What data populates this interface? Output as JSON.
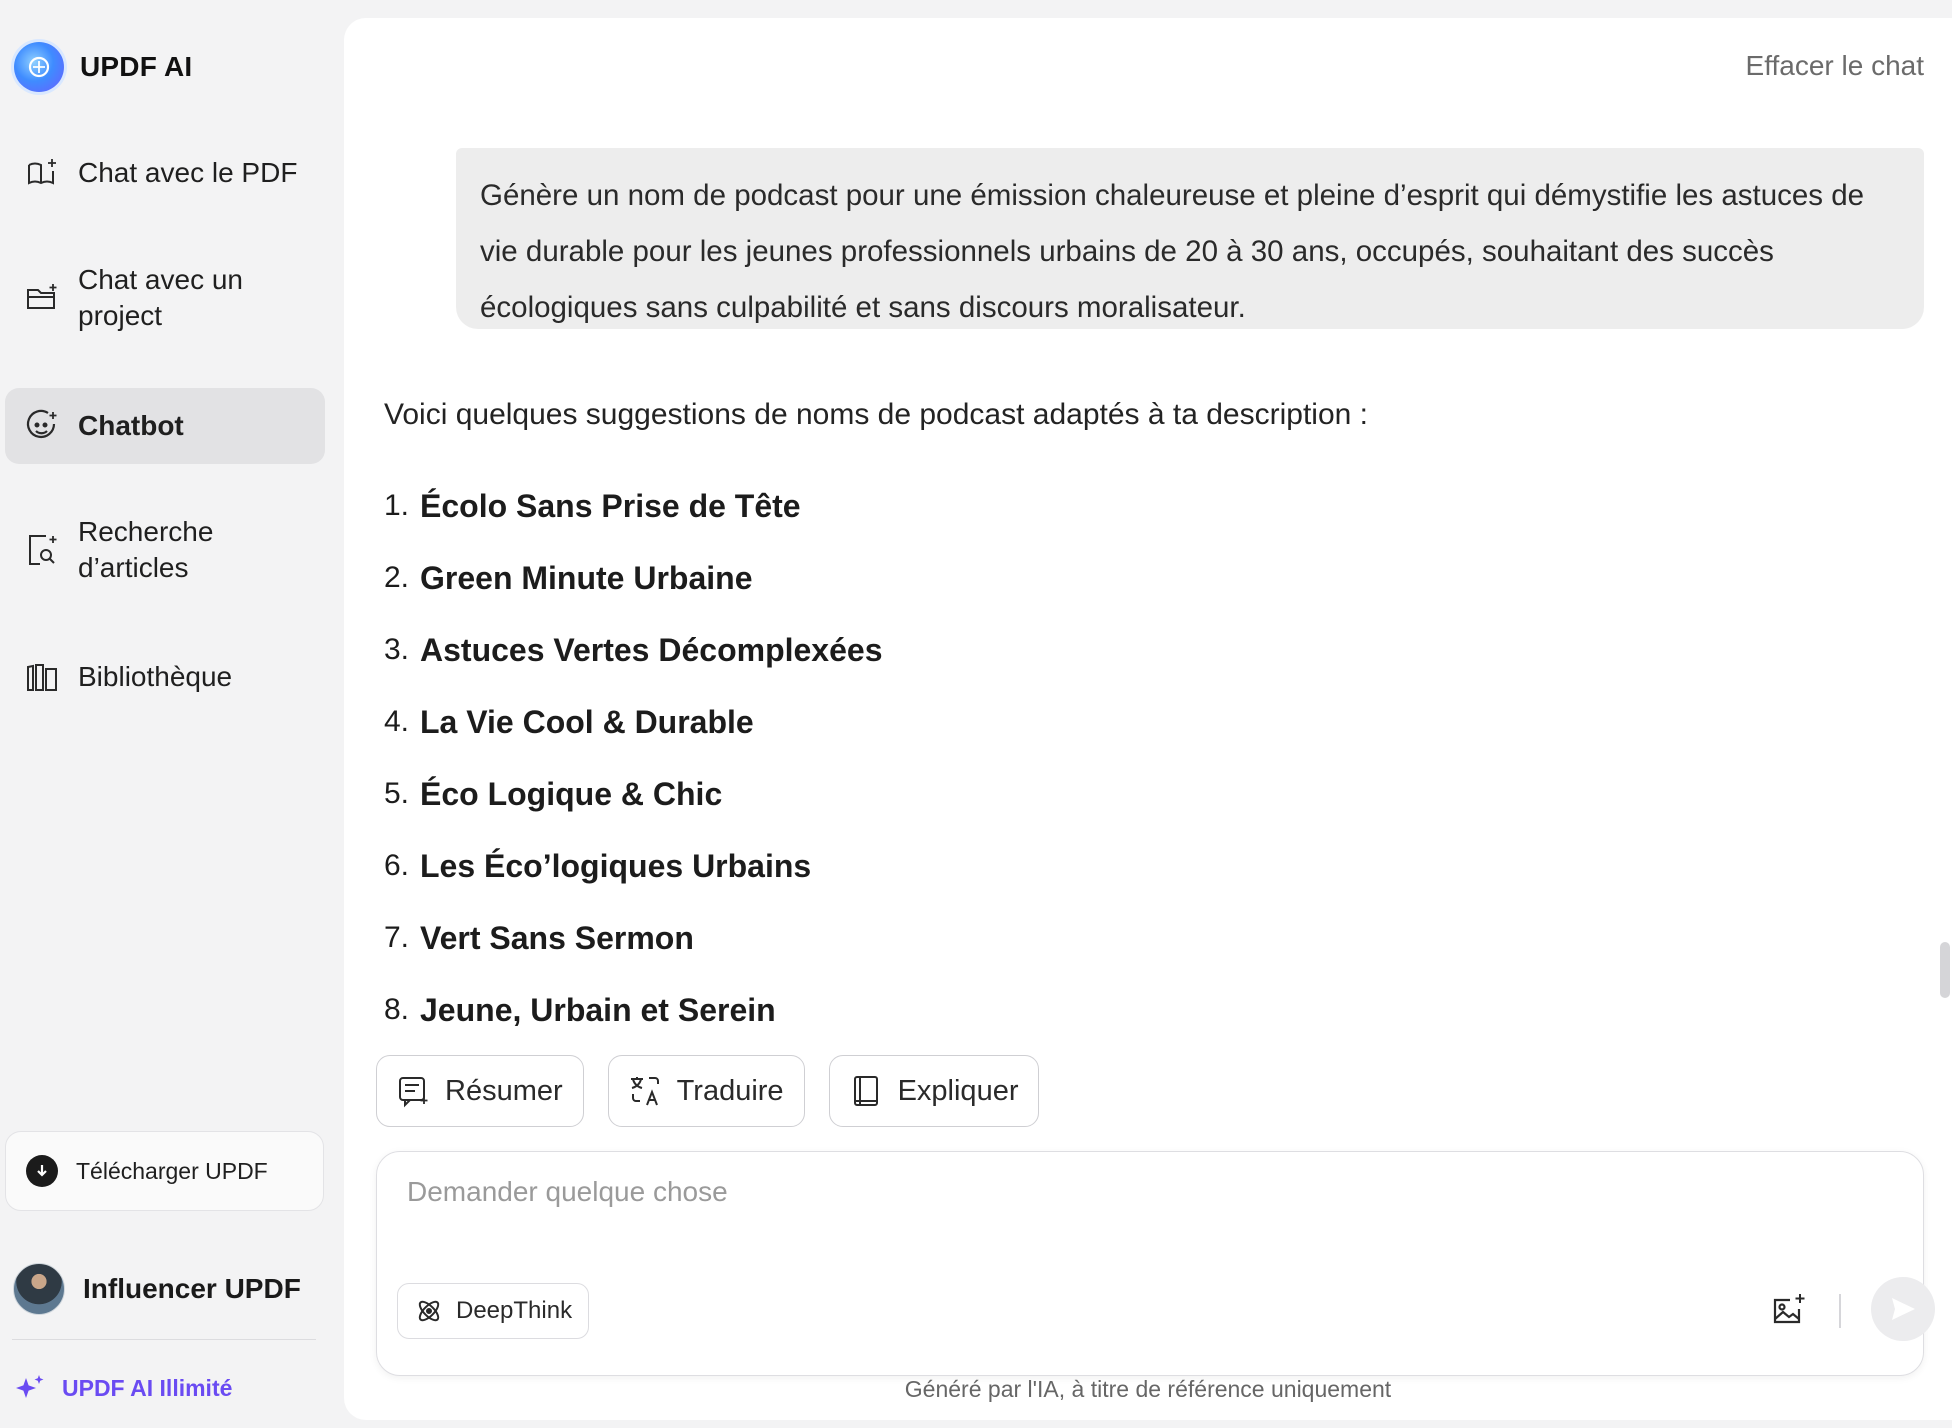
{
  "brand": {
    "name": "UPDF AI"
  },
  "sidebar": {
    "items": [
      {
        "label": "Chat avec le PDF",
        "icon": "book-sparkle-icon"
      },
      {
        "label": "Chat avec un project",
        "icon": "folder-sparkle-icon"
      },
      {
        "label": "Chatbot",
        "icon": "chatbot-face-icon",
        "active": true
      },
      {
        "label": "Recherche d’articles",
        "icon": "document-search-icon"
      },
      {
        "label": "Bibliothèque",
        "icon": "library-icon"
      }
    ],
    "download_label": "Télécharger UPDF",
    "user_name": "Influencer UPDF",
    "upgrade_label": "UPDF AI Illimité"
  },
  "header": {
    "clear_chat": "Effacer le chat"
  },
  "conversation": {
    "user_message": "Génère un nom de podcast pour une émission chaleureuse et pleine d’esprit qui démystifie les astuces de vie durable pour les jeunes professionnels urbains de 20 à 30 ans, occupés, souhaitant des succès écologiques sans culpabilité et sans discours moralisateur.",
    "answer_intro": "Voici quelques suggestions de noms de podcast adaptés à ta description :",
    "suggestions": [
      {
        "num": "1.",
        "text": "Écolo Sans Prise de Tête"
      },
      {
        "num": "2.",
        "text": "Green Minute Urbaine"
      },
      {
        "num": "3.",
        "text": "Astuces Vertes Décomplexées"
      },
      {
        "num": "4.",
        "text": "La Vie Cool & Durable"
      },
      {
        "num": "5.",
        "text": "Éco Logique & Chic"
      },
      {
        "num": "6.",
        "text": "Les Éco’logiques Urbains"
      },
      {
        "num": "7.",
        "text": "Vert Sans Sermon"
      },
      {
        "num": "8.",
        "text": "Jeune, Urbain et Serein"
      }
    ]
  },
  "actions": {
    "summarize": "Résumer",
    "translate": "Traduire",
    "explain": "Expliquer"
  },
  "composer": {
    "placeholder": "Demander quelque chose",
    "deepthink_label": "DeepThink"
  },
  "footer": {
    "disclaimer": "Généré par l'IA, à titre de référence uniquement"
  },
  "colors": {
    "accent": "#6a4bf2",
    "sidebar_bg": "#f3f3f4",
    "active_item_bg": "#e2e2e4",
    "bubble_bg": "#ededed"
  }
}
